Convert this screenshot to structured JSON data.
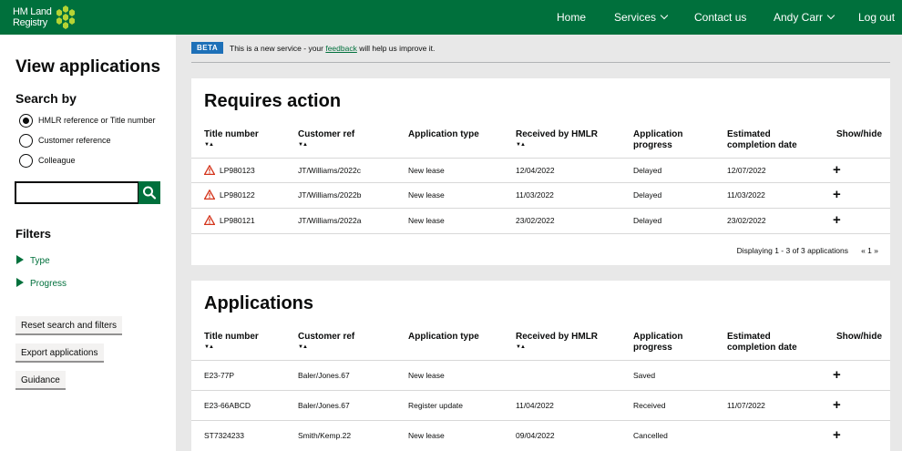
{
  "header": {
    "logo_line1": "HM Land",
    "logo_line2": "Registry",
    "nav": {
      "home": "Home",
      "services": "Services",
      "contact": "Contact us",
      "user": "Andy Carr",
      "logout": "Log out"
    }
  },
  "sidebar": {
    "title": "View applications",
    "search_by": "Search by",
    "radios": [
      "HMLR reference or Title number",
      "Customer reference",
      "Colleague"
    ],
    "selected_radio": 0,
    "search_value": "",
    "filters_heading": "Filters",
    "filters": [
      "Type",
      "Progress"
    ],
    "buttons": {
      "reset": "Reset search and filters",
      "export": "Export applications",
      "guidance": "Guidance"
    }
  },
  "banner": {
    "tag": "BETA",
    "text_before": "This is a new service - your ",
    "link": "feedback",
    "text_after": " will help us improve it."
  },
  "columns": {
    "title": "Title number",
    "cust": "Customer ref",
    "type": "Application type",
    "received": "Received by HMLR",
    "progress_1": "Application",
    "progress_2": "progress",
    "estimated_1": "Estimated",
    "estimated_2": "completion date",
    "show": "Show/hide",
    "sort": "▼▲"
  },
  "requires_action": {
    "title": "Requires action",
    "rows": [
      {
        "title": "LP980123",
        "cust": "JT/Williams/2022c",
        "type": "New lease",
        "received": "12/04/2022",
        "progress": "Delayed",
        "estimated": "12/07/2022"
      },
      {
        "title": "LP980122",
        "cust": "JT/Williams/2022b",
        "type": "New lease",
        "received": "11/03/2022",
        "progress": "Delayed",
        "estimated": "11/03/2022"
      },
      {
        "title": "LP980121",
        "cust": "JT/Williams/2022a",
        "type": "New lease",
        "received": "23/02/2022",
        "progress": "Delayed",
        "estimated": "23/02/2022"
      }
    ],
    "displaying": "Displaying 1 - 3 of 3 applications",
    "pagination": "« 1 »"
  },
  "applications": {
    "title": "Applications",
    "rows": [
      {
        "title": "E23-77P",
        "cust": "Baler/Jones.67",
        "type": "New lease",
        "received": "",
        "progress": "Saved",
        "estimated": ""
      },
      {
        "title": "E23-66ABCD",
        "cust": "Baler/Jones.67",
        "type": "Register update",
        "received": "11/04/2022",
        "progress": "Received",
        "estimated": "11/07/2022"
      },
      {
        "title": "ST7324233",
        "cust": "Smith/Kemp.22",
        "type": "New lease",
        "received": "09/04/2022",
        "progress": "Cancelled",
        "estimated": ""
      }
    ]
  },
  "icons": {
    "plus": "+",
    "warning": "warning-icon",
    "search": "search-icon"
  },
  "colors": {
    "brand_green": "#00703c",
    "beta_blue": "#1d70b8",
    "warning_red": "#d4351c"
  }
}
